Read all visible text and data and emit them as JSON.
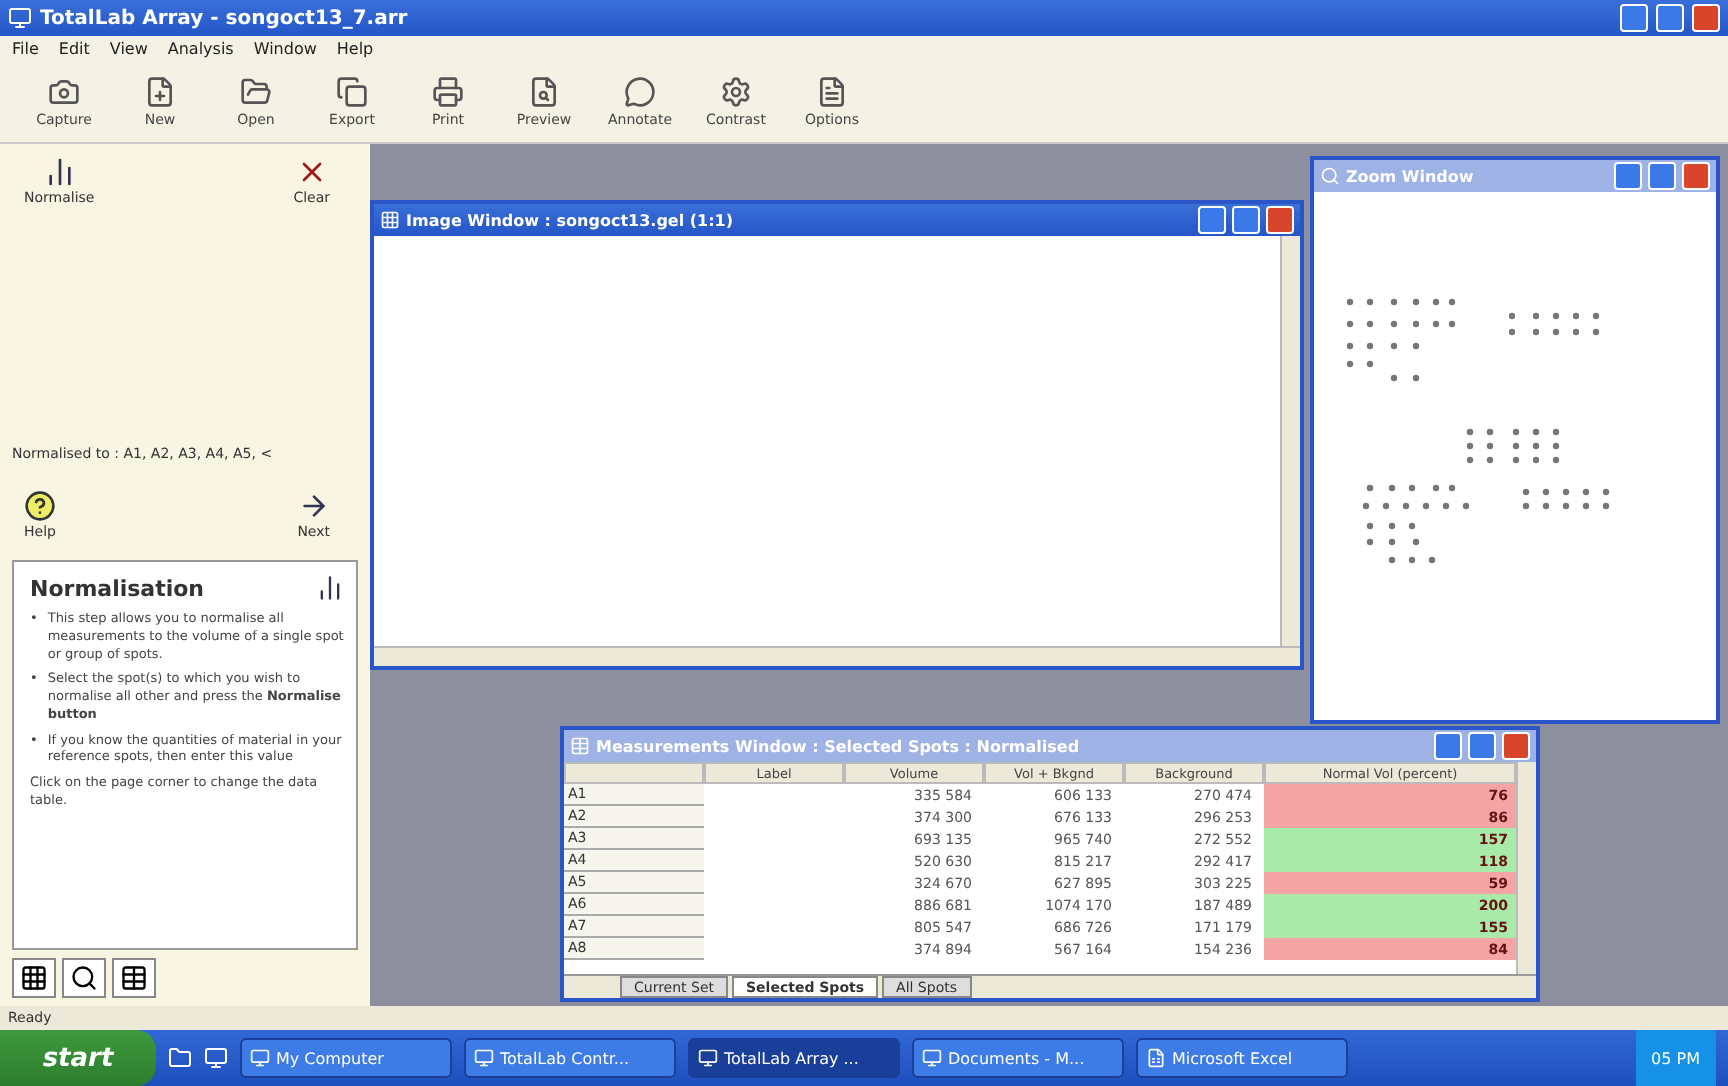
{
  "window": {
    "title": "TotalLab Array - songoct13_7.arr"
  },
  "menu": [
    "File",
    "Edit",
    "View",
    "Analysis",
    "Window",
    "Help"
  ],
  "toolbar": [
    {
      "label": "Capture",
      "kind": "capture"
    },
    {
      "label": "New",
      "kind": "new"
    },
    {
      "label": "Open",
      "kind": "open"
    },
    {
      "label": "Export",
      "kind": "export"
    },
    {
      "label": "Print",
      "kind": "print"
    },
    {
      "label": "Preview",
      "kind": "preview"
    },
    {
      "label": "Annotate",
      "kind": "annotate"
    },
    {
      "label": "Contrast",
      "kind": "contrast"
    },
    {
      "label": "Options",
      "kind": "options"
    }
  ],
  "step_panel": {
    "actions": [
      {
        "label": "Normalise",
        "kind": "normalise"
      },
      {
        "label": "Clear",
        "kind": "clear"
      }
    ],
    "normalised_to": "Normalised to : A1, A2, A3, A4, A5, <",
    "nav": [
      {
        "label": "Help",
        "kind": "help"
      },
      {
        "label": "Next",
        "kind": "next"
      }
    ],
    "help_card": {
      "title": "Normalisation",
      "marker": "•",
      "bullets": [
        "This step allows you to normalise all measurements to the volume of a single spot or group of spots.",
        "Select the spot(s) to which you wish to normalise all other and press the **Normalise button**",
        "If you know the quantities of material in your reference spots, then enter this value"
      ],
      "footer": "Click on the page corner to change the data table."
    }
  },
  "image_window": {
    "title": "Image Window : songoct13.gel (1:1)"
  },
  "zoom_window": {
    "title": "Zoom Window"
  },
  "table_window": {
    "title": "Measurements Window : Selected Spots : Normalised",
    "columns": [
      "Label",
      "Volume",
      "Vol + Bkgnd",
      "Background",
      "Normal Vol (percent)"
    ],
    "rows": [
      {
        "spot": "A1",
        "volume": "335 584",
        "vol_bkgnd": "606 133",
        "background": "270 474",
        "normal": "76",
        "color": "#f4a4a4"
      },
      {
        "spot": "A2",
        "volume": "374 300",
        "vol_bkgnd": "676 133",
        "background": "296 253",
        "normal": "86",
        "color": "#f4a4a4"
      },
      {
        "spot": "A3",
        "volume": "693 135",
        "vol_bkgnd": "965 740",
        "background": "272 552",
        "normal": "157",
        "color": "#a8eaa8"
      },
      {
        "spot": "A4",
        "volume": "520 630",
        "vol_bkgnd": "815 217",
        "background": "292 417",
        "normal": "118",
        "color": "#a8eaa8"
      },
      {
        "spot": "A5",
        "volume": "324 670",
        "vol_bkgnd": "627 895",
        "background": "303 225",
        "normal": "59",
        "color": "#f4a4a4"
      },
      {
        "spot": "A6",
        "volume": "886 681",
        "vol_bkgnd": "1074 170",
        "background": "187 489",
        "normal": "200",
        "color": "#a8eaa8"
      },
      {
        "spot": "A7",
        "volume": "805 547",
        "vol_bkgnd": "686 726",
        "background": "171 179",
        "normal": "155",
        "color": "#a8eaa8"
      },
      {
        "spot": "A8",
        "volume": "374 894",
        "vol_bkgnd": "567 164",
        "background": "154 236",
        "normal": "84",
        "color": "#f4a4a4"
      }
    ],
    "tabs": [
      {
        "label": "Current Set",
        "selected": false
      },
      {
        "label": "Selected Spots",
        "selected": true
      },
      {
        "label": "All Spots",
        "selected": false
      }
    ]
  },
  "status_bar": "Ready",
  "taskbar": {
    "start": "start",
    "items": [
      {
        "label": "My Computer",
        "selected": false
      },
      {
        "label": "TotalLab Contr...",
        "selected": false
      },
      {
        "label": "TotalLab Array ...",
        "selected": true
      },
      {
        "label": "Documents - M...",
        "selected": false
      },
      {
        "label": "Microsoft Excel",
        "selected": false
      }
    ],
    "clock": "05 PM"
  }
}
